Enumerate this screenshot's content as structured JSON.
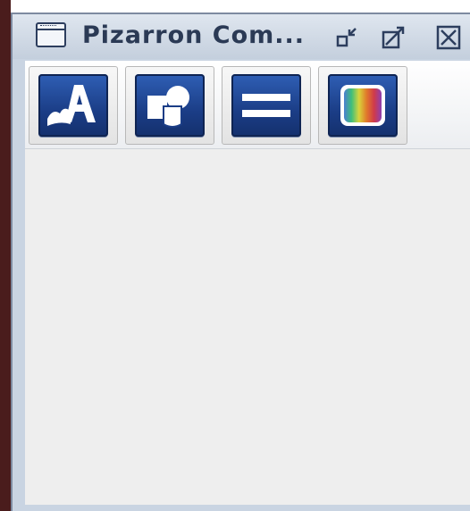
{
  "window": {
    "title": "Pizarron Com..."
  },
  "titlebar_buttons": [
    {
      "name": "minimize",
      "icon": "minimize-icon"
    },
    {
      "name": "maximize",
      "icon": "maximize-icon"
    },
    {
      "name": "close",
      "icon": "close-icon"
    }
  ],
  "toolbar": {
    "tools": [
      {
        "icon": "text-draw-icon"
      },
      {
        "icon": "shapes-icon"
      },
      {
        "icon": "lines-icon"
      },
      {
        "icon": "color-palette-icon"
      }
    ]
  },
  "colors": {
    "titlebar": "#c9d4e2",
    "title_text": "#2b3a55",
    "tool_face": "#1b3d86",
    "content_background": "#eeeeee",
    "left_edge": "#4a1c1c"
  }
}
